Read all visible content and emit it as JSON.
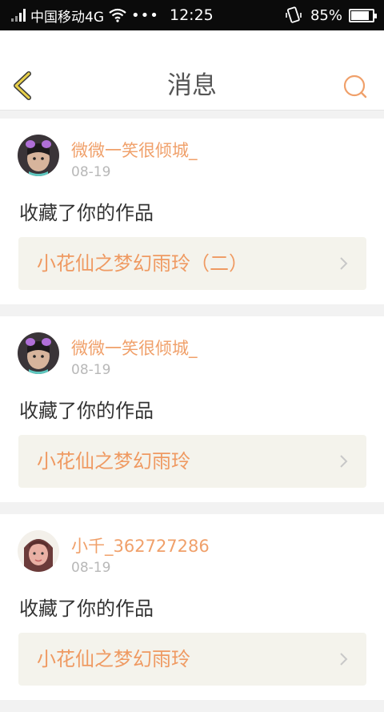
{
  "status_bar": {
    "carrier": "中国移动4G",
    "dots": "•••",
    "time": "12:25",
    "battery_percent": "85%",
    "battery_level": 0.85
  },
  "header": {
    "title": "消息",
    "back_icon": "chevron-left-icon",
    "search_icon": "search-icon"
  },
  "colors": {
    "accent": "#f0a06a",
    "back_icon": "#e8d04a",
    "text_primary": "#333333",
    "text_secondary": "#b8b8b8",
    "work_background": "#f4f3ec"
  },
  "messages": [
    {
      "username": "微微一笑很倾城_",
      "date": "08-19",
      "action": "收藏了你的作品",
      "work_title": "小花仙之梦幻雨玲（二）"
    },
    {
      "username": "微微一笑很倾城_",
      "date": "08-19",
      "action": "收藏了你的作品",
      "work_title": "小花仙之梦幻雨玲"
    },
    {
      "username": "小千_362727286",
      "date": "08-19",
      "action": "收藏了你的作品",
      "work_title": "小花仙之梦幻雨玲"
    }
  ]
}
